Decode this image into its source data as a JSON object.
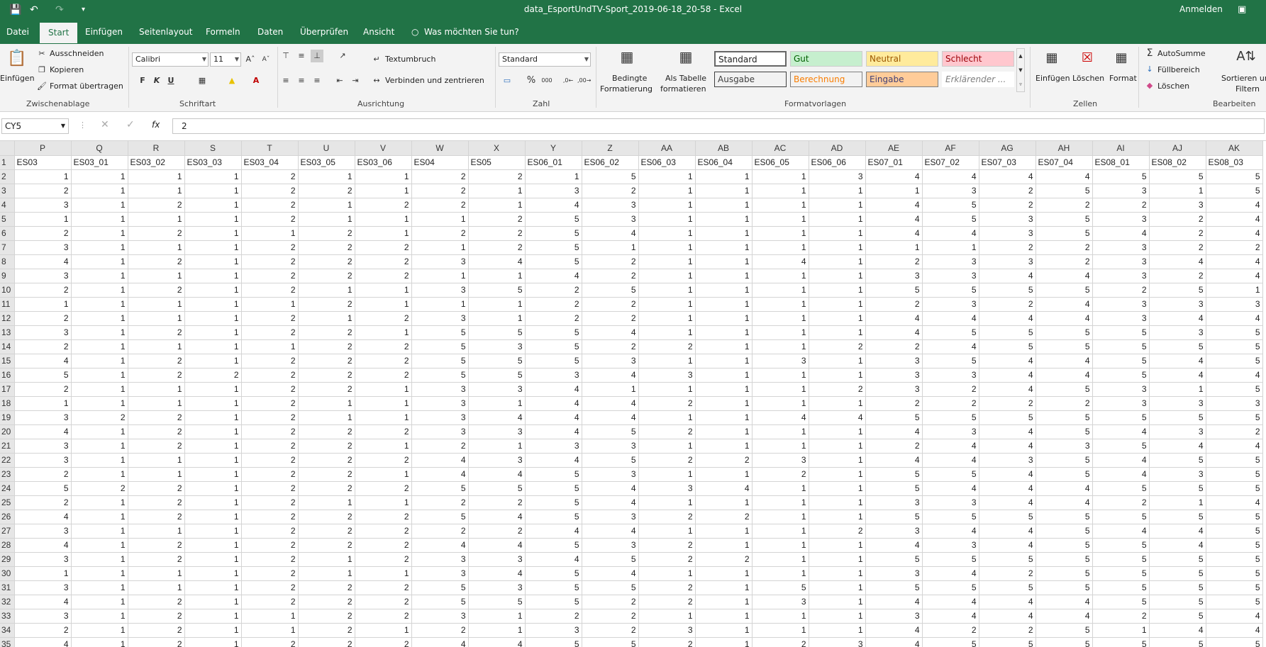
{
  "app": {
    "title": "data_EsportUndTV-Sport_2019-06-18_20-58  -  Excel",
    "signin": "Anmelden"
  },
  "tabs": [
    "Datei",
    "Start",
    "Einfügen",
    "Seitenlayout",
    "Formeln",
    "Daten",
    "Überprüfen",
    "Ansicht",
    "Was möchten Sie tun?"
  ],
  "ribbon": {
    "clipboard": {
      "paste": "Einfügen",
      "cut": "Ausschneiden",
      "copy": "Kopieren",
      "format_painter": "Format übertragen",
      "label": "Zwischenablage"
    },
    "font": {
      "name": "Calibri",
      "size": "11",
      "bold": "F",
      "italic": "K",
      "underline": "U",
      "label": "Schriftart"
    },
    "alignment": {
      "wrap": "Textumbruch",
      "merge": "Verbinden und zentrieren",
      "label": "Ausrichtung"
    },
    "number": {
      "format": "Standard",
      "label": "Zahl"
    },
    "styles": {
      "cond1": "Bedingte",
      "cond2": "Formatierung",
      "table1": "Als Tabelle",
      "table2": "formatieren",
      "standard": "Standard",
      "gut": "Gut",
      "neutral": "Neutral",
      "schlecht": "Schlecht",
      "ausgabe": "Ausgabe",
      "berechnung": "Berechnung",
      "eingabe": "Eingabe",
      "erklaerend": "Erklärender ...",
      "label": "Formatvorlagen"
    },
    "cells": {
      "insert": "Einfügen",
      "delete": "Löschen",
      "format": "Format",
      "label": "Zellen"
    },
    "edit": {
      "autosum": "AutoSumme",
      "fill": "Füllbereich",
      "clear": "Löschen",
      "sort1": "Sortieren und",
      "sort2": "Filtern",
      "label": "Bearbeiten"
    }
  },
  "formula_bar": {
    "namebox": "CY5",
    "value": "2"
  },
  "grid": {
    "columns": [
      "P",
      "Q",
      "R",
      "S",
      "T",
      "U",
      "V",
      "W",
      "X",
      "Y",
      "Z",
      "AA",
      "AB",
      "AC",
      "AD",
      "AE",
      "AF",
      "AG",
      "AH",
      "AI",
      "AJ",
      "AK"
    ],
    "headers": [
      "ES03",
      "ES03_01",
      "ES03_02",
      "ES03_03",
      "ES03_04",
      "ES03_05",
      "ES03_06",
      "ES04",
      "ES05",
      "ES06_01",
      "ES06_02",
      "ES06_03",
      "ES06_04",
      "ES06_05",
      "ES06_06",
      "ES07_01",
      "ES07_02",
      "ES07_03",
      "ES07_04",
      "ES08_01",
      "ES08_02",
      "ES08_03"
    ],
    "rows": [
      [
        1,
        1,
        1,
        1,
        2,
        1,
        1,
        2,
        2,
        1,
        5,
        1,
        1,
        1,
        3,
        4,
        4,
        4,
        4,
        5,
        5,
        5
      ],
      [
        2,
        1,
        1,
        1,
        2,
        2,
        1,
        2,
        1,
        3,
        2,
        1,
        1,
        1,
        1,
        1,
        3,
        2,
        5,
        3,
        1,
        5
      ],
      [
        3,
        1,
        2,
        1,
        2,
        1,
        2,
        2,
        1,
        4,
        3,
        1,
        1,
        1,
        1,
        4,
        5,
        2,
        2,
        2,
        3,
        4
      ],
      [
        1,
        1,
        1,
        1,
        2,
        1,
        1,
        1,
        2,
        5,
        3,
        1,
        1,
        1,
        1,
        4,
        5,
        3,
        5,
        3,
        2,
        4
      ],
      [
        2,
        1,
        2,
        1,
        1,
        2,
        1,
        2,
        2,
        5,
        4,
        1,
        1,
        1,
        1,
        4,
        4,
        3,
        5,
        4,
        2,
        4
      ],
      [
        3,
        1,
        1,
        1,
        2,
        2,
        2,
        1,
        2,
        5,
        1,
        1,
        1,
        1,
        1,
        1,
        1,
        2,
        2,
        3,
        2,
        2
      ],
      [
        4,
        1,
        2,
        1,
        2,
        2,
        2,
        3,
        4,
        5,
        2,
        1,
        1,
        4,
        1,
        2,
        3,
        3,
        2,
        3,
        4,
        4
      ],
      [
        3,
        1,
        1,
        1,
        2,
        2,
        2,
        1,
        1,
        4,
        2,
        1,
        1,
        1,
        1,
        3,
        3,
        4,
        4,
        3,
        2,
        4
      ],
      [
        2,
        1,
        2,
        1,
        2,
        1,
        1,
        3,
        5,
        2,
        5,
        1,
        1,
        1,
        1,
        5,
        5,
        5,
        5,
        2,
        5,
        1
      ],
      [
        1,
        1,
        1,
        1,
        1,
        2,
        1,
        1,
        1,
        2,
        2,
        1,
        1,
        1,
        1,
        2,
        3,
        2,
        4,
        3,
        3,
        3
      ],
      [
        2,
        1,
        1,
        1,
        2,
        1,
        2,
        3,
        1,
        2,
        2,
        1,
        1,
        1,
        1,
        4,
        4,
        4,
        4,
        3,
        4,
        4
      ],
      [
        3,
        1,
        2,
        1,
        2,
        2,
        1,
        5,
        5,
        5,
        4,
        1,
        1,
        1,
        1,
        4,
        5,
        5,
        5,
        5,
        3,
        5
      ],
      [
        2,
        1,
        1,
        1,
        1,
        2,
        2,
        5,
        3,
        5,
        2,
        2,
        1,
        1,
        2,
        2,
        4,
        5,
        5,
        5,
        5,
        5
      ],
      [
        4,
        1,
        2,
        1,
        2,
        2,
        2,
        5,
        5,
        5,
        3,
        1,
        1,
        3,
        1,
        3,
        5,
        4,
        4,
        5,
        4,
        5
      ],
      [
        5,
        1,
        2,
        2,
        2,
        2,
        2,
        5,
        5,
        3,
        4,
        3,
        1,
        1,
        1,
        3,
        3,
        4,
        4,
        5,
        4,
        4
      ],
      [
        2,
        1,
        1,
        1,
        2,
        2,
        1,
        3,
        3,
        4,
        1,
        1,
        1,
        1,
        2,
        3,
        2,
        4,
        5,
        3,
        1,
        5
      ],
      [
        1,
        1,
        1,
        1,
        2,
        1,
        1,
        3,
        1,
        4,
        4,
        2,
        1,
        1,
        1,
        2,
        2,
        2,
        2,
        3,
        3,
        3
      ],
      [
        3,
        2,
        2,
        1,
        2,
        1,
        1,
        3,
        4,
        4,
        4,
        1,
        1,
        4,
        4,
        5,
        5,
        5,
        5,
        5,
        5,
        5
      ],
      [
        4,
        1,
        2,
        1,
        2,
        2,
        2,
        3,
        3,
        4,
        5,
        2,
        1,
        1,
        1,
        4,
        3,
        4,
        5,
        4,
        3,
        2
      ],
      [
        3,
        1,
        2,
        1,
        2,
        2,
        1,
        2,
        1,
        3,
        3,
        1,
        1,
        1,
        1,
        2,
        4,
        4,
        3,
        5,
        4,
        4
      ],
      [
        3,
        1,
        1,
        1,
        2,
        2,
        2,
        4,
        3,
        4,
        5,
        2,
        2,
        3,
        1,
        4,
        4,
        3,
        5,
        4,
        5,
        5
      ],
      [
        2,
        1,
        1,
        1,
        2,
        2,
        1,
        4,
        4,
        5,
        3,
        1,
        1,
        2,
        1,
        5,
        5,
        4,
        5,
        4,
        3,
        5
      ],
      [
        5,
        2,
        2,
        1,
        2,
        2,
        2,
        5,
        5,
        5,
        4,
        3,
        4,
        1,
        1,
        5,
        4,
        4,
        4,
        5,
        5,
        5
      ],
      [
        2,
        1,
        2,
        1,
        2,
        1,
        1,
        2,
        2,
        5,
        4,
        1,
        1,
        1,
        1,
        3,
        3,
        4,
        4,
        2,
        1,
        4
      ],
      [
        4,
        1,
        2,
        1,
        2,
        2,
        2,
        5,
        4,
        5,
        3,
        2,
        2,
        1,
        1,
        5,
        5,
        5,
        5,
        5,
        5,
        5
      ],
      [
        3,
        1,
        1,
        1,
        2,
        2,
        2,
        2,
        2,
        4,
        4,
        1,
        1,
        1,
        2,
        3,
        4,
        4,
        5,
        4,
        4,
        5
      ],
      [
        4,
        1,
        2,
        1,
        2,
        2,
        2,
        4,
        4,
        5,
        3,
        2,
        1,
        1,
        1,
        4,
        3,
        4,
        5,
        5,
        4,
        5
      ],
      [
        3,
        1,
        2,
        1,
        2,
        1,
        2,
        3,
        3,
        4,
        5,
        2,
        2,
        1,
        1,
        5,
        5,
        5,
        5,
        5,
        5,
        5
      ],
      [
        1,
        1,
        1,
        1,
        2,
        1,
        1,
        3,
        4,
        5,
        4,
        1,
        1,
        1,
        1,
        3,
        4,
        2,
        5,
        5,
        5,
        5
      ],
      [
        3,
        1,
        1,
        1,
        2,
        2,
        2,
        5,
        3,
        5,
        5,
        2,
        1,
        5,
        1,
        5,
        5,
        5,
        5,
        5,
        5,
        5
      ],
      [
        4,
        1,
        2,
        1,
        2,
        2,
        2,
        5,
        5,
        5,
        2,
        2,
        1,
        3,
        1,
        4,
        4,
        4,
        4,
        5,
        5,
        5
      ],
      [
        3,
        1,
        2,
        1,
        1,
        2,
        2,
        3,
        1,
        2,
        2,
        1,
        1,
        1,
        1,
        3,
        4,
        4,
        4,
        2,
        5,
        4
      ],
      [
        2,
        1,
        2,
        1,
        1,
        2,
        1,
        2,
        1,
        3,
        2,
        3,
        1,
        1,
        1,
        4,
        2,
        2,
        5,
        1,
        4,
        4
      ],
      [
        4,
        1,
        2,
        1,
        2,
        2,
        2,
        4,
        4,
        5,
        5,
        2,
        1,
        2,
        3,
        4,
        5,
        5,
        5,
        5,
        5,
        5
      ]
    ]
  }
}
